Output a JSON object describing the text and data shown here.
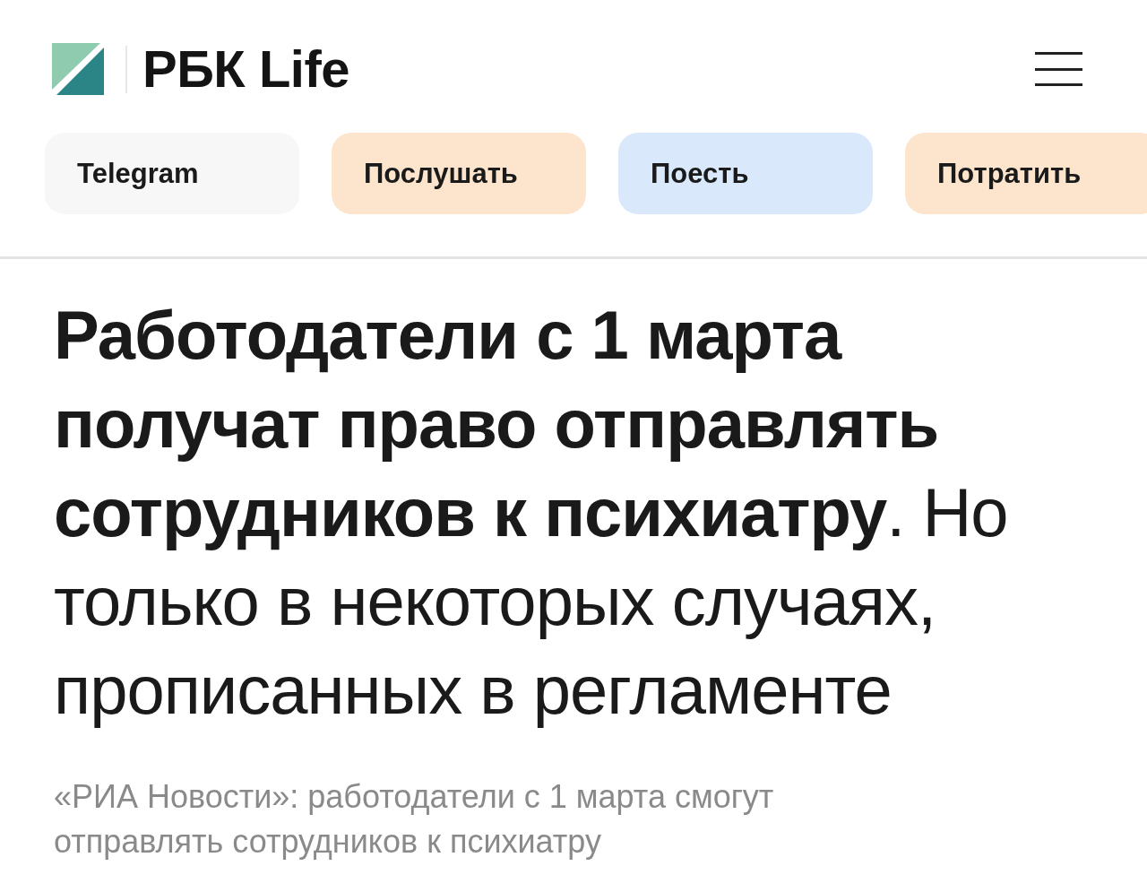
{
  "header": {
    "logo_text": "РБК Life"
  },
  "nav": [
    {
      "label": "Telegram",
      "color": "#f7f7f7"
    },
    {
      "label": "Послушать",
      "color": "#fde4cc"
    },
    {
      "label": "Поесть",
      "color": "#d9e9fb"
    },
    {
      "label": "Потратить",
      "color": "#fde4cc"
    }
  ],
  "article": {
    "headline": "**Работодатели с 1 марта получат право отправлять сотрудников к психиатру**. Но только в некоторых случаях, прописанных в регламенте",
    "source_note": "«РИА Новости»: работодатели с 1 марта смогут отправлять сотрудников к психиатру"
  }
}
